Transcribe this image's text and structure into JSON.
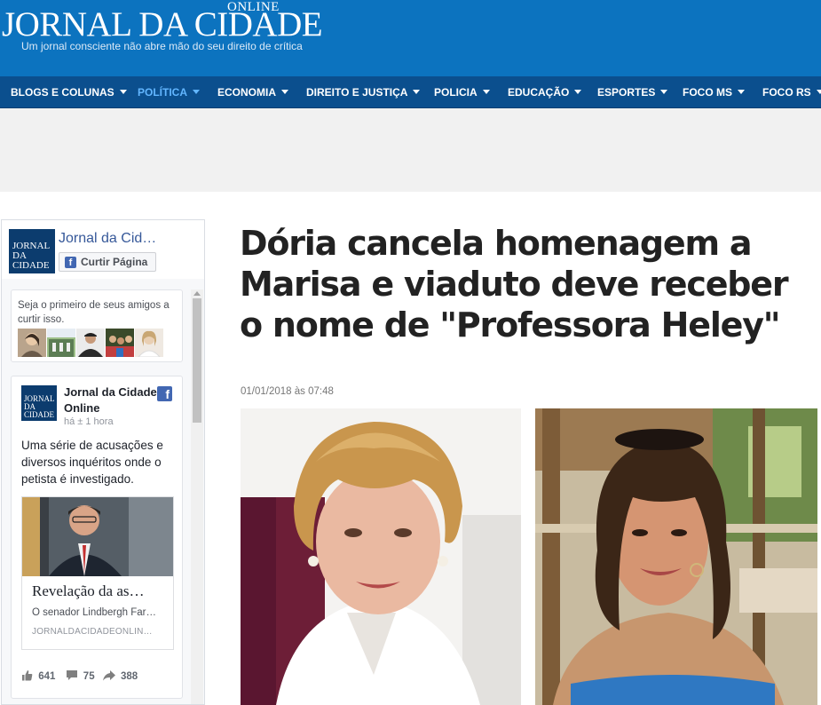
{
  "header": {
    "logo_title": "JORNAL DA CIDADE",
    "logo_online": "ONLINE",
    "logo_tagline": "Um jornal consciente não abre mão do seu direito de crítica",
    "bg_color": "#0c73bf"
  },
  "nav": {
    "items": [
      {
        "label": "BLOGS E COLUNAS",
        "active": false
      },
      {
        "label": "POLÍTICA",
        "active": true
      },
      {
        "label": "ECONOMIA",
        "active": false
      },
      {
        "label": "DIREITO E JUSTIÇA",
        "active": false
      },
      {
        "label": "POLICIA",
        "active": false
      },
      {
        "label": "EDUCAÇÃO",
        "active": false
      },
      {
        "label": "ESPORTES",
        "active": false
      },
      {
        "label": "FOCO MS",
        "active": false
      },
      {
        "label": "FOCO RS",
        "active": false
      }
    ],
    "bg_color": "#0b4f8e",
    "active_color": "#62b6ff"
  },
  "fb_widget": {
    "page_name": "Jornal da Cid…",
    "logo_line1": "JORNAL",
    "logo_line2": "DA CIDADE",
    "like_button": "Curtir Página",
    "friends_text": "Seja o primeiro de seus amigos a curtir isso.",
    "post": {
      "author": "Jornal da Cidade Online",
      "time": "há ± 1 hora",
      "text": "Uma série de acusações e diversos inquéritos onde o petista é investigado.",
      "link_title": "Revelação da as…",
      "link_desc": "O senador Lindbergh Far…",
      "link_domain": "JORNALDACIDADEONLIN…",
      "likes": "641",
      "comments": "75",
      "shares": "388"
    }
  },
  "article": {
    "title": "Dória cancela homenagem a Marisa e viaduto deve receber o nome de \"Professora Heley\"",
    "date": "01/01/2018 às 07:48"
  }
}
